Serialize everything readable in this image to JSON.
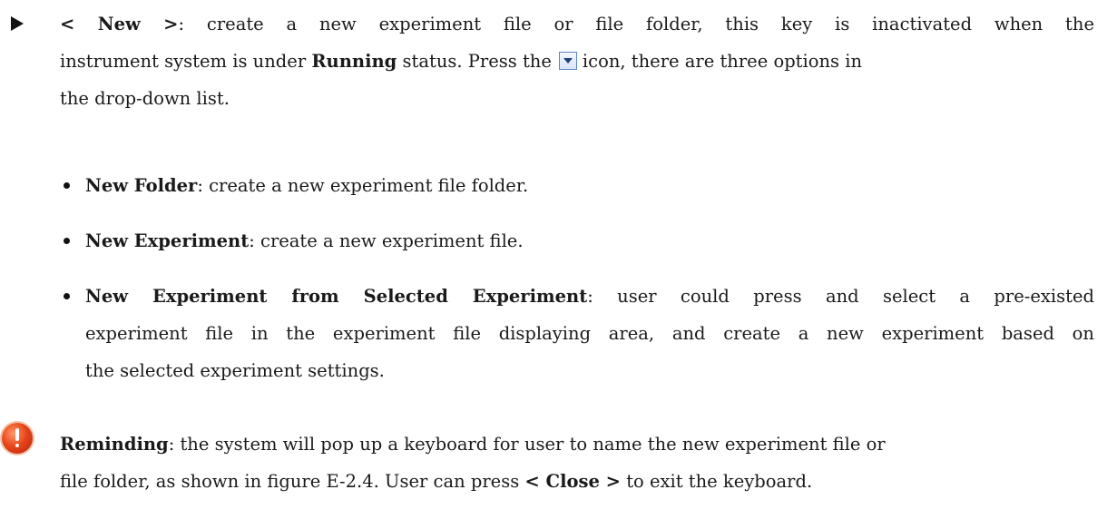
{
  "main_bullet": {
    "key_label": "< New >",
    "line1_text": ": create a new experiment file or file folder, this key is inactivated when the",
    "line2_before": "instrument system is under ",
    "line2_bold": "Running",
    "line2_after": " status. Press the",
    "line2_end": "icon, there are three options in",
    "line3_text": "the drop-down list."
  },
  "sub_bullets": [
    {
      "title": "New Folder",
      "text": ": create a new experiment file folder."
    },
    {
      "title": "New Experiment",
      "text": ": create a new experiment file."
    },
    {
      "title": "New Experiment from Selected Experiment",
      "line1_text": ": user could press and select a pre-existed",
      "line2_text": "experiment file in the experiment file displaying area, and create a new experiment based on",
      "line3_text": "the selected experiment settings."
    }
  ],
  "reminder": {
    "title": "Reminding",
    "line1_text": ": the system will pop up a keyboard for user to name the new experiment file or",
    "line2_before": "file folder, as shown in figure E-2.4. User can press ",
    "line2_bold": "< Close >",
    "line2_after": " to exit the keyboard."
  },
  "icons": {
    "bullet": "triangle-bullet-icon",
    "dropdown": "dropdown-arrow-icon",
    "warning": "warning-exclamation-icon"
  },
  "colors": {
    "text": "#1a1a1a",
    "dropdown_border": "#5b86c4",
    "warning": "#e8461a"
  }
}
